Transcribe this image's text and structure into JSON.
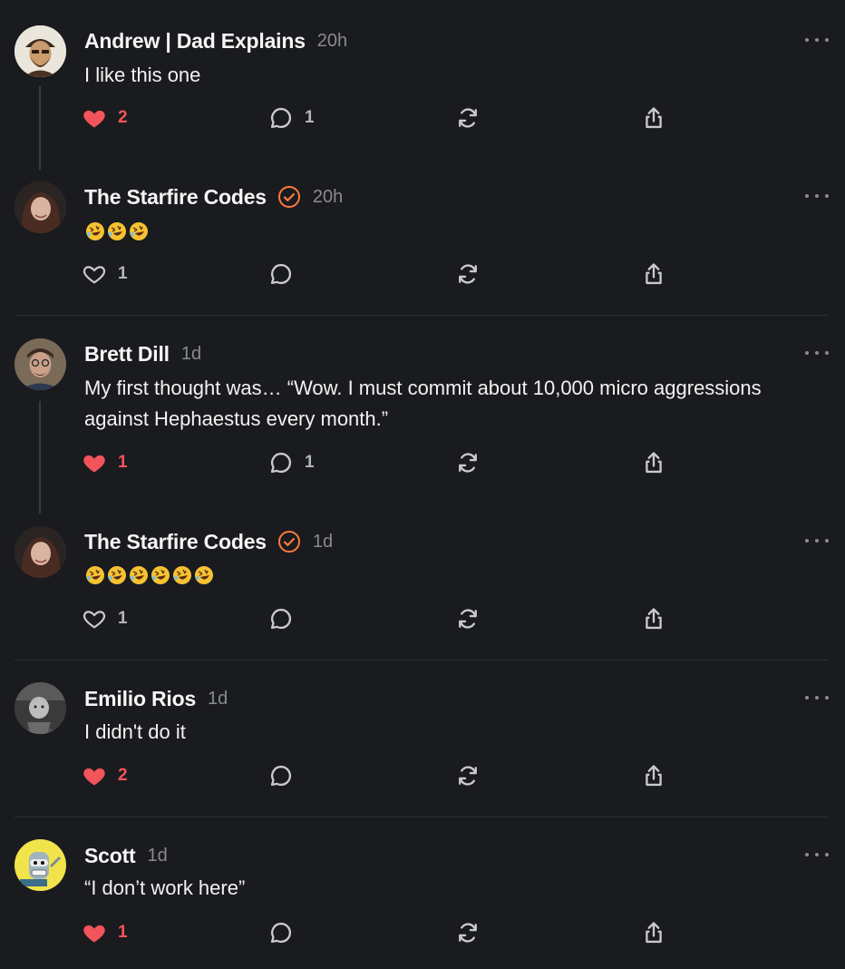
{
  "posts": [
    {
      "author": "Andrew | Dad Explains",
      "time": "20h",
      "text": "I like this one",
      "likes": "2",
      "liked": true,
      "comments": "1",
      "verified": false,
      "avatar_icon": "avatar-andrew"
    },
    {
      "author": "The Starfire Codes",
      "time": "20h",
      "emojis": [
        "rofl-emoji",
        "rofl-emoji",
        "rofl-emoji"
      ],
      "likes": "1",
      "liked": false,
      "comments": "",
      "verified": true,
      "avatar_icon": "avatar-starfire"
    },
    {
      "author": "Brett Dill",
      "time": "1d",
      "text": "My first thought was… “Wow. I must commit about 10,000 micro aggressions against Hephaestus every month.”",
      "likes": "1",
      "liked": true,
      "comments": "1",
      "verified": false,
      "avatar_icon": "avatar-brett"
    },
    {
      "author": "The Starfire Codes",
      "time": "1d",
      "emojis": [
        "rofl-emoji",
        "rofl-emoji",
        "rofl-emoji",
        "rofl-emoji",
        "rofl-emoji",
        "rofl-emoji"
      ],
      "likes": "1",
      "liked": false,
      "comments": "",
      "verified": true,
      "avatar_icon": "avatar-starfire"
    },
    {
      "author": "Emilio Rios",
      "time": "1d",
      "text": "I didn't do it",
      "likes": "2",
      "liked": true,
      "comments": "",
      "verified": false,
      "avatar_icon": "avatar-emilio"
    },
    {
      "author": "Scott",
      "time": "1d",
      "text": "“I don’t work here”",
      "likes": "1",
      "liked": true,
      "comments": "",
      "verified": false,
      "avatar_icon": "avatar-scott"
    }
  ],
  "colors": {
    "background": "#1a1b1e",
    "like": "#f2545b",
    "verified": "#ff7a3d",
    "muted": "#8a8b90"
  }
}
